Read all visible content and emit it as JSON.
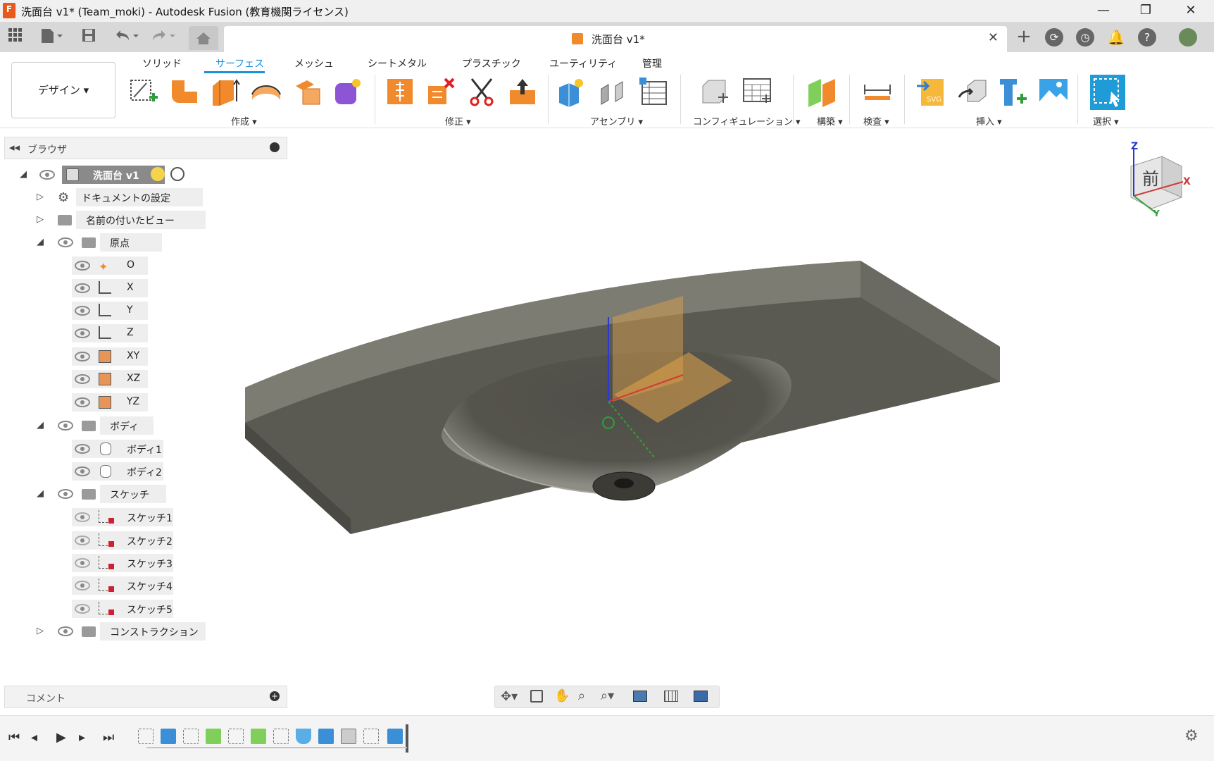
{
  "window": {
    "title": "洗面台 v1* (Team_moki) - Autodesk Fusion (教育機関ライセンス)",
    "app_icon_letter": "F",
    "minimize": "—",
    "maximize": "❐",
    "close": "✕"
  },
  "document_tab": {
    "label": "洗面台 v1*",
    "close": "✕"
  },
  "workspace_button": "デザイン ▾",
  "ribbon_tabs": [
    "ソリッド",
    "サーフェス",
    "メッシュ",
    "シートメタル",
    "プラスチック",
    "ユーティリティ",
    "管理"
  ],
  "active_tab": "サーフェス",
  "ribbon_groups": {
    "create": "作成 ▾",
    "modify": "修正 ▾",
    "assemble": "アセンブリ ▾",
    "configure": "コンフィギュレーション ▾",
    "construct": "構築 ▾",
    "inspect": "検査 ▾",
    "insert": "挿入 ▾",
    "select": "選択 ▾"
  },
  "browser": {
    "title": "ブラウザ",
    "root": "洗面台 v1",
    "items": {
      "document_settings": "ドキュメントの設定",
      "named_views": "名前の付いたビュー",
      "origin": "原点",
      "origin_children": [
        "O",
        "X",
        "Y",
        "Z",
        "XY",
        "XZ",
        "YZ"
      ],
      "bodies": "ボディ",
      "body_children": [
        "ボディ1",
        "ボディ2"
      ],
      "sketches": "スケッチ",
      "sketch_children": [
        "スケッチ1",
        "スケッチ2",
        "スケッチ3",
        "スケッチ4",
        "スケッチ5"
      ],
      "construction": "コンストラクション"
    }
  },
  "comments": {
    "title": "コメント"
  },
  "viewcube": {
    "face_label": "前",
    "axis_z": "Z",
    "axis_x": "X",
    "axis_y": "Y"
  },
  "colors": {
    "accent": "#1f8fd8",
    "body": "#5b5a52",
    "plane": "#e2a44a",
    "app_orange": "#e8591a"
  }
}
